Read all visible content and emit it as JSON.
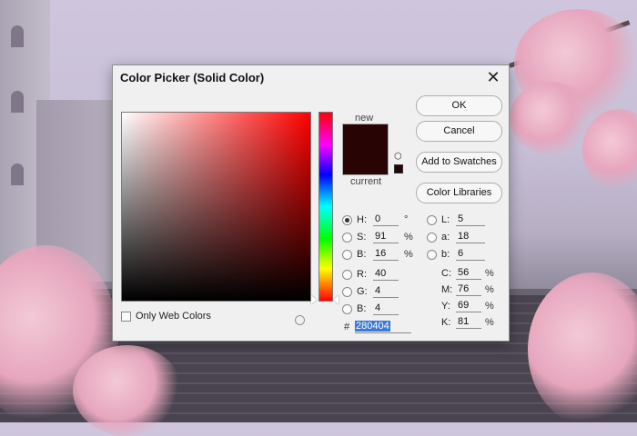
{
  "dialog": {
    "title": "Color Picker (Solid Color)",
    "close_symbol": "✕"
  },
  "preview": {
    "new_label": "new",
    "current_label": "current",
    "new_color": "#280404",
    "current_color": "#280404"
  },
  "picker": {
    "hue_base_color": "#ff0000",
    "only_web_colors_label": "Only Web Colors",
    "only_web_colors_checked": false
  },
  "buttons": {
    "ok": "OK",
    "cancel": "Cancel",
    "add_to_swatches": "Add to Swatches",
    "color_libraries": "Color Libraries"
  },
  "hsb": {
    "h_label": "H:",
    "h_value": "0",
    "h_unit": "°",
    "s_label": "S:",
    "s_value": "91",
    "s_unit": "%",
    "b_label": "B:",
    "b_value": "16",
    "b_unit": "%"
  },
  "rgb": {
    "r_label": "R:",
    "r_value": "40",
    "g_label": "G:",
    "g_value": "4",
    "b_label": "B:",
    "b_value": "4"
  },
  "lab": {
    "l_label": "L:",
    "l_value": "5",
    "a_label": "a:",
    "a_value": "18",
    "b_label": "b:",
    "b_value": "6"
  },
  "cmyk": {
    "c_label": "C:",
    "c_value": "56",
    "c_unit": "%",
    "m_label": "M:",
    "m_value": "76",
    "m_unit": "%",
    "y_label": "Y:",
    "y_value": "69",
    "y_unit": "%",
    "k_label": "K:",
    "k_value": "81",
    "k_unit": "%"
  },
  "hex": {
    "hash": "#",
    "value": "280404"
  },
  "icons": {
    "close": "close-icon",
    "out_of_gamut": "cube-icon",
    "web_safe": "gamut-square-icon"
  }
}
